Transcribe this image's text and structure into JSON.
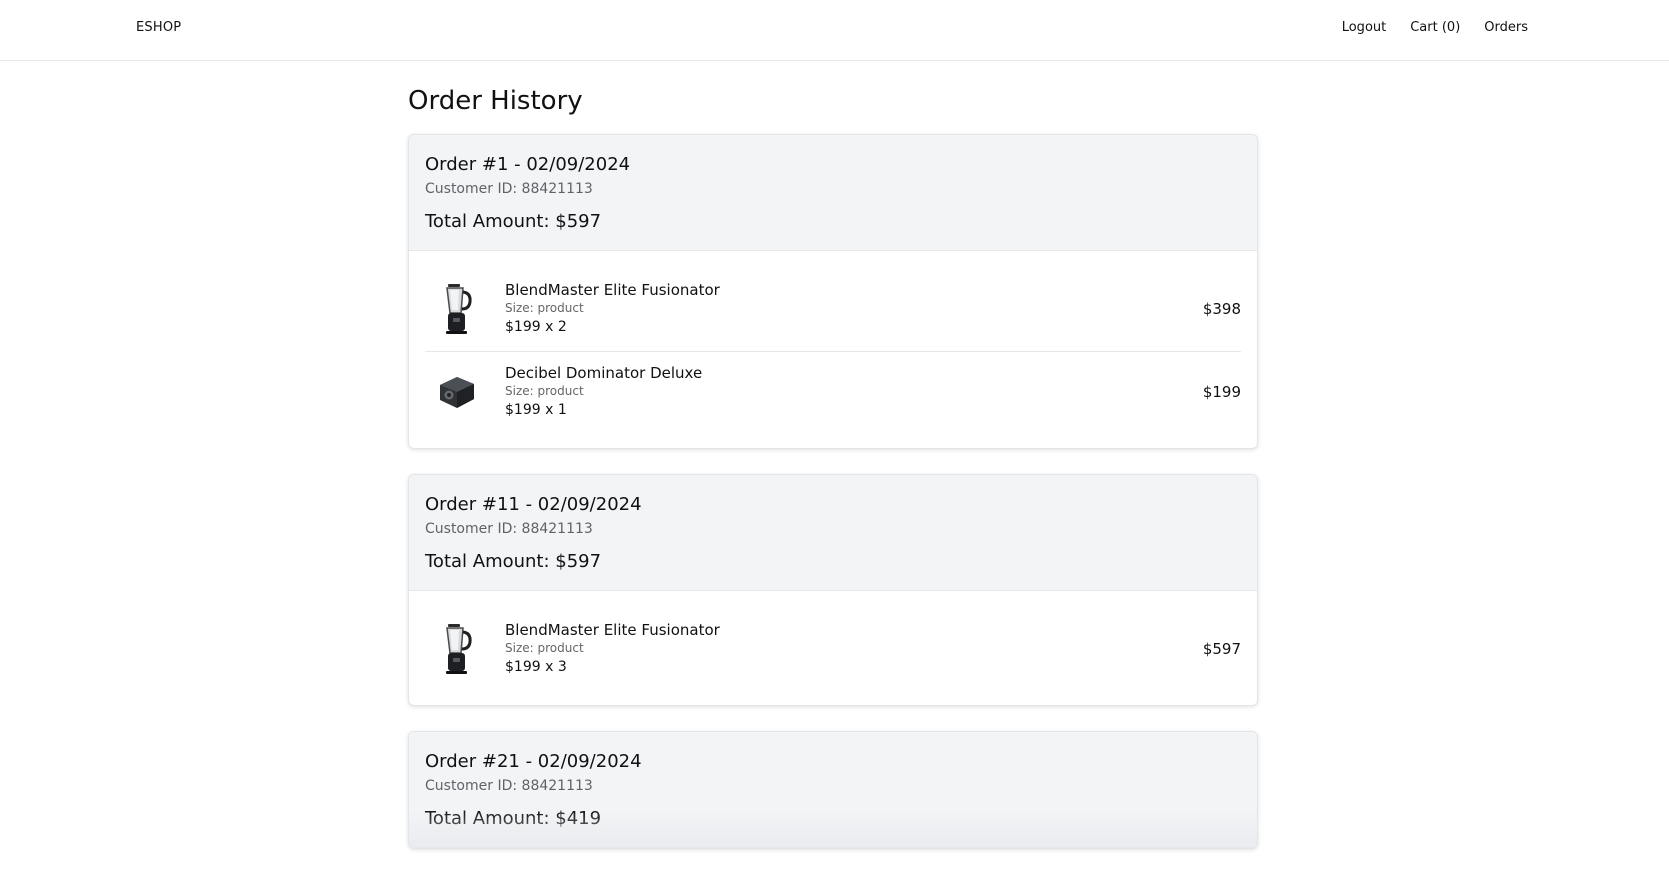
{
  "brand": "ESHOP",
  "nav": {
    "logout": "Logout",
    "cart": "Cart (0)",
    "orders": "Orders"
  },
  "page": {
    "title": "Order History"
  },
  "orders": [
    {
      "title": "Order #1 - 02/09/2024",
      "customer": "Customer ID: 88421113",
      "total": "Total Amount: $597",
      "items": [
        {
          "name": "BlendMaster Elite Fusionator",
          "size": "Size: product",
          "qty": "$199 x 2",
          "price": "$398",
          "icon": "blender-icon"
        },
        {
          "name": "Decibel Dominator Deluxe",
          "size": "Size: product",
          "qty": "$199 x 1",
          "price": "$199",
          "icon": "speaker-icon"
        }
      ]
    },
    {
      "title": "Order #11 - 02/09/2024",
      "customer": "Customer ID: 88421113",
      "total": "Total Amount: $597",
      "items": [
        {
          "name": "BlendMaster Elite Fusionator",
          "size": "Size: product",
          "qty": "$199 x 3",
          "price": "$597",
          "icon": "blender-icon"
        }
      ]
    },
    {
      "title": "Order #21 - 02/09/2024",
      "customer": "Customer ID: 88421113",
      "total": "Total Amount: $419",
      "items": []
    }
  ]
}
